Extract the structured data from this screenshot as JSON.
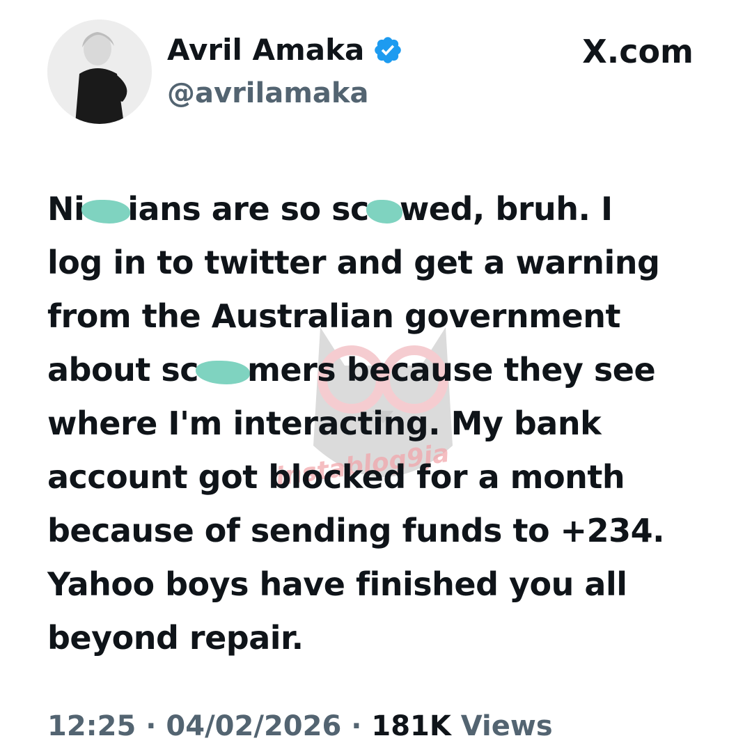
{
  "author": {
    "name": "Avril Amaka",
    "handle": "@avrilamaka",
    "verified": true,
    "verified_color": "#1d9bf0"
  },
  "site": "X.com",
  "post": {
    "lines": [
      [
        "Ni",
        "",
        "ians are so sc",
        "",
        "wed, bruh. I"
      ],
      [
        "log in to twitter and get a warning"
      ],
      [
        "from the Australian government"
      ],
      [
        "about sc",
        "",
        "mers because they see"
      ],
      [
        "where I'm interacting. My bank"
      ],
      [
        "account got blocked for a month"
      ],
      [
        "because of sending funds to +234."
      ],
      [
        "Yahoo boys have finished you all"
      ],
      [
        "beyond repair."
      ]
    ]
  },
  "meta": {
    "time": "12:25",
    "date": "04/02/2026",
    "views_count": "181K",
    "views_label": "Views",
    "separator": "·"
  },
  "watermark": {
    "text": "instablog9ja"
  },
  "colors": {
    "text": "#0f1419",
    "secondary": "#536471",
    "censor": "#7fd3c0"
  }
}
